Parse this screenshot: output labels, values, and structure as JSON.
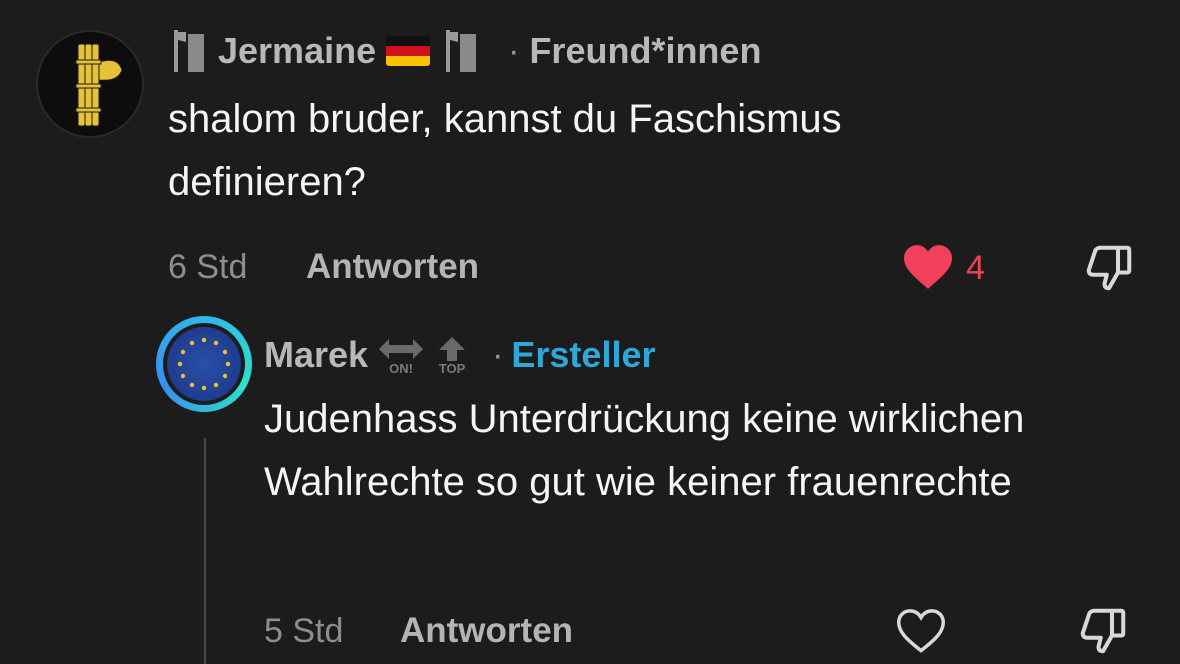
{
  "comments": [
    {
      "author": "Jermaine",
      "role": "Freund*innen",
      "text": "shalom bruder, kannst du Faschismus definieren?",
      "time": "6 Std",
      "reply_label": "Antworten",
      "likes": "4",
      "liked": true
    }
  ],
  "reply": {
    "author": "Marek",
    "badge_on": "ON!",
    "badge_top": "TOP",
    "role": "Ersteller",
    "text": "Judenhass Unterdrückung keine wirklichen Wahlrechte so gut wie keiner frauenrechte",
    "time": "5 Std",
    "reply_label": "Antworten",
    "liked": false
  },
  "meta_separator": "·",
  "colors": {
    "background": "#1c1c1c",
    "like_red": "#f0405a",
    "creator_blue": "#2ea8d8",
    "eu_blue": "#1f3d8f"
  },
  "icons": [
    "fasces-avatar",
    "axe-icon",
    "german-flag-icon",
    "eu-flag-avatar",
    "arrows-icon",
    "heart-icon",
    "dislike-icon"
  ]
}
